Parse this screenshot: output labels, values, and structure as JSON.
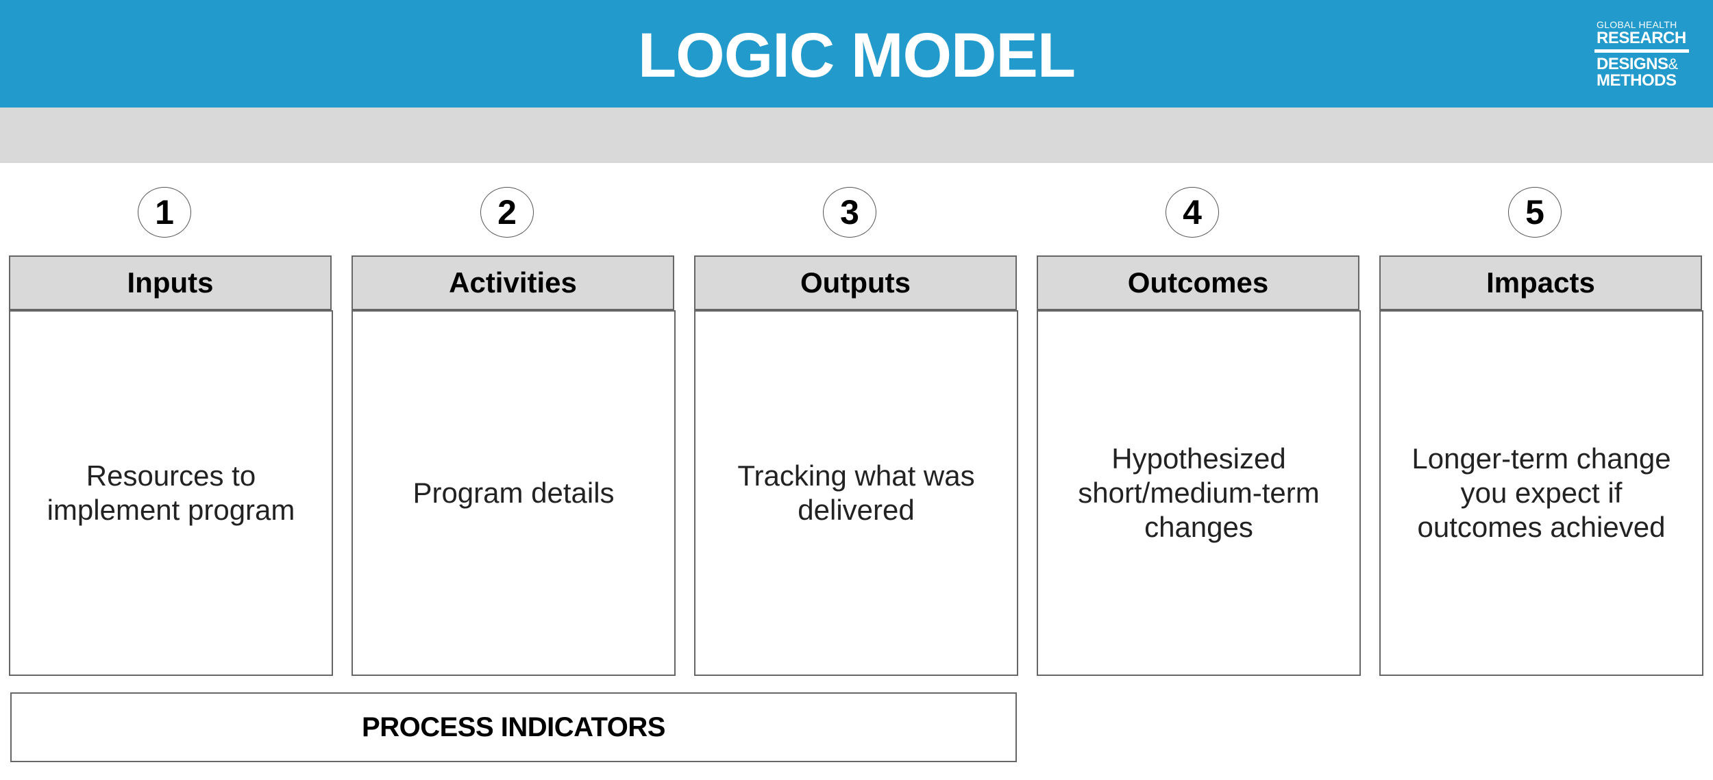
{
  "header": {
    "title": "LOGIC MODEL",
    "logo": {
      "line1": "GLOBAL HEALTH",
      "line2": "RESEARCH",
      "line3": "DESIGNS",
      "ampersand": "&",
      "line4": "METHODS"
    }
  },
  "columns": [
    {
      "number": "1",
      "heading": "Inputs",
      "description": "Resources to implement program"
    },
    {
      "number": "2",
      "heading": "Activities",
      "description": "Program details"
    },
    {
      "number": "3",
      "heading": "Outputs",
      "description": "Tracking what was delivered"
    },
    {
      "number": "4",
      "heading": "Outcomes",
      "description": "Hypothesized short/medium-term changes"
    },
    {
      "number": "5",
      "heading": "Impacts",
      "description": "Longer-term change you expect if outcomes achieved"
    }
  ],
  "process_indicators": {
    "label": "PROCESS INDICATORS"
  },
  "colors": {
    "header_bg": "#229acb",
    "band_bg": "#d9d9d9",
    "border": "#666666"
  }
}
